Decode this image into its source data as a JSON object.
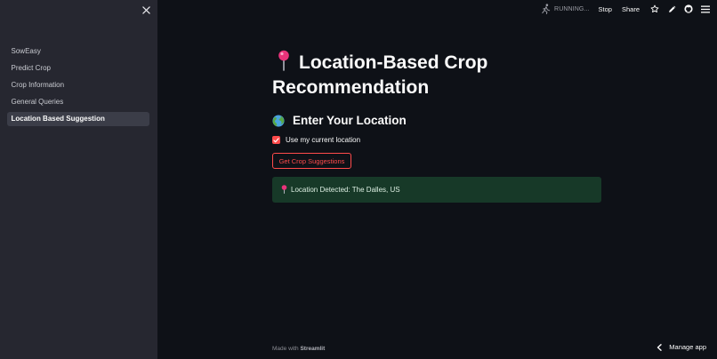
{
  "sidebar": {
    "items": [
      {
        "label": "SowEasy",
        "active": false
      },
      {
        "label": "Predict Crop",
        "active": false
      },
      {
        "label": "Crop Information",
        "active": false
      },
      {
        "label": "General Queries",
        "active": false
      },
      {
        "label": "Location Based Suggestion",
        "active": true
      }
    ]
  },
  "topbar": {
    "status": "RUNNING...",
    "stop_label": "Stop",
    "share_label": "Share",
    "icons": [
      "star-icon",
      "pencil-icon",
      "github-icon",
      "hamburger-menu-icon"
    ]
  },
  "main": {
    "title": "Location-Based Crop Recommendation",
    "subheader": "Enter Your Location",
    "checkbox_label": "Use my current location",
    "checkbox_checked": true,
    "button_label": "Get Crop Suggestions",
    "alert_text": "Location Detected: The Dalles, US"
  },
  "footer": {
    "prefix": "Made with",
    "brand": "Streamlit"
  },
  "manage_app_label": "Manage app",
  "colors": {
    "background": "#0e1117",
    "sidebar": "#262730",
    "accent": "#ff4b4b",
    "success_bg": "#173928"
  }
}
